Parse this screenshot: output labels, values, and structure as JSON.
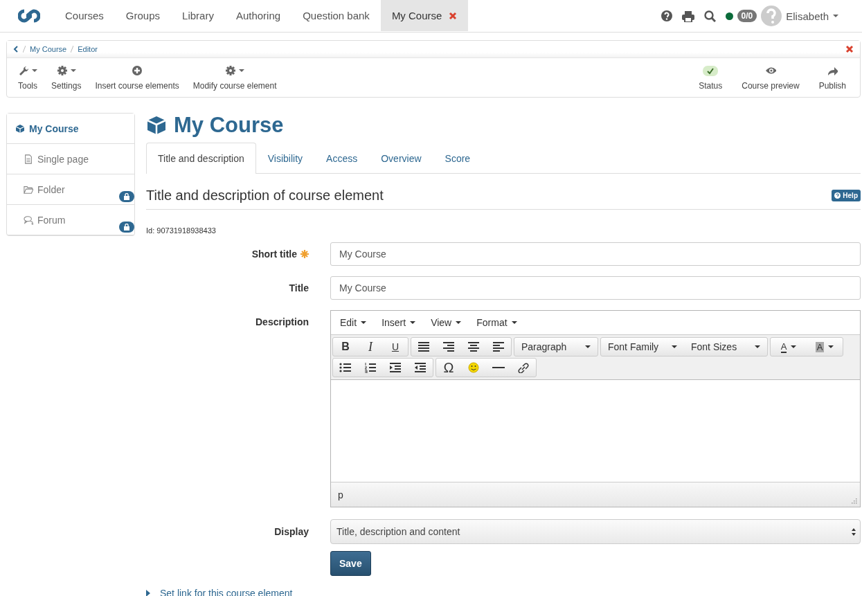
{
  "top_nav": {
    "items": [
      {
        "label": "Courses",
        "selected": false,
        "closable": false
      },
      {
        "label": "Groups",
        "selected": false,
        "closable": false
      },
      {
        "label": "Library",
        "selected": false,
        "closable": false
      },
      {
        "label": "Authoring",
        "selected": false,
        "closable": false
      },
      {
        "label": "Question bank",
        "selected": false,
        "closable": false
      },
      {
        "label": "My Course",
        "selected": true,
        "closable": true
      }
    ],
    "online": true,
    "badge": "0/0",
    "user": "Elisabeth"
  },
  "breadcrumb": [
    "My Course",
    "Editor"
  ],
  "toolbar": {
    "left": [
      {
        "label": "Tools",
        "kind": "wrench",
        "dropdown": true
      },
      {
        "label": "Settings",
        "kind": "gear",
        "dropdown": true
      },
      {
        "label": "Insert course elements",
        "kind": "plus",
        "dropdown": false
      },
      {
        "label": "Modify course element",
        "kind": "gear",
        "dropdown": true
      }
    ],
    "right": [
      {
        "label": "Status",
        "kind": "check",
        "dropdown": false
      },
      {
        "label": "Course preview",
        "kind": "eye",
        "dropdown": false
      },
      {
        "label": "Publish",
        "kind": "share",
        "dropdown": false
      }
    ]
  },
  "tree": {
    "label": "My Course",
    "selected": true,
    "children": [
      {
        "label": "Single page",
        "kind": "page",
        "locked": false
      },
      {
        "label": "Folder",
        "kind": "folder",
        "locked": true
      },
      {
        "label": "Forum",
        "kind": "forum",
        "locked": true
      }
    ]
  },
  "heading": "My Course",
  "tabs": [
    {
      "label": "Title and description",
      "selected": true
    },
    {
      "label": "Visibility",
      "selected": false
    },
    {
      "label": "Access",
      "selected": false
    },
    {
      "label": "Overview",
      "selected": false
    },
    {
      "label": "Score",
      "selected": false
    }
  ],
  "section": {
    "title": "Title and description of course element",
    "help": "Help"
  },
  "id_text": "Id: 90731918938433",
  "fields": [
    {
      "label": "Short title",
      "required": true,
      "value": "My Course"
    },
    {
      "label": "Title",
      "required": false,
      "value": "My Course"
    }
  ],
  "description": {
    "label": "Description",
    "menus": [
      "Edit",
      "Insert",
      "View",
      "Format"
    ],
    "toolbar_rows": [
      [
        [
          {
            "kind": "bold",
            "text": "B"
          },
          {
            "kind": "italic",
            "text": "I"
          },
          {
            "kind": "underline",
            "text": "U"
          }
        ],
        [
          {
            "kind": "align-justify"
          },
          {
            "kind": "align-right"
          },
          {
            "kind": "align-center"
          },
          {
            "kind": "align-left"
          }
        ],
        [
          {
            "kind": "select",
            "text": "Paragraph"
          }
        ],
        [
          {
            "kind": "select",
            "text": "Font Family"
          },
          {
            "kind": "select",
            "text": "Font Sizes"
          }
        ],
        [
          {
            "kind": "text-color",
            "text": "A"
          },
          {
            "kind": "bg-color",
            "text": "A"
          }
        ]
      ],
      [
        [
          {
            "kind": "bullets"
          },
          {
            "kind": "numbers"
          },
          {
            "kind": "outdent"
          },
          {
            "kind": "indent"
          }
        ],
        [
          {
            "kind": "glyph",
            "text": "Ω"
          },
          {
            "kind": "emoticon"
          },
          {
            "kind": "rule"
          },
          {
            "kind": "link"
          }
        ]
      ]
    ],
    "path": "p"
  },
  "display": {
    "label": "Display",
    "value": "Title, description and content"
  },
  "save": "Save",
  "link": "Set link for this course element"
}
